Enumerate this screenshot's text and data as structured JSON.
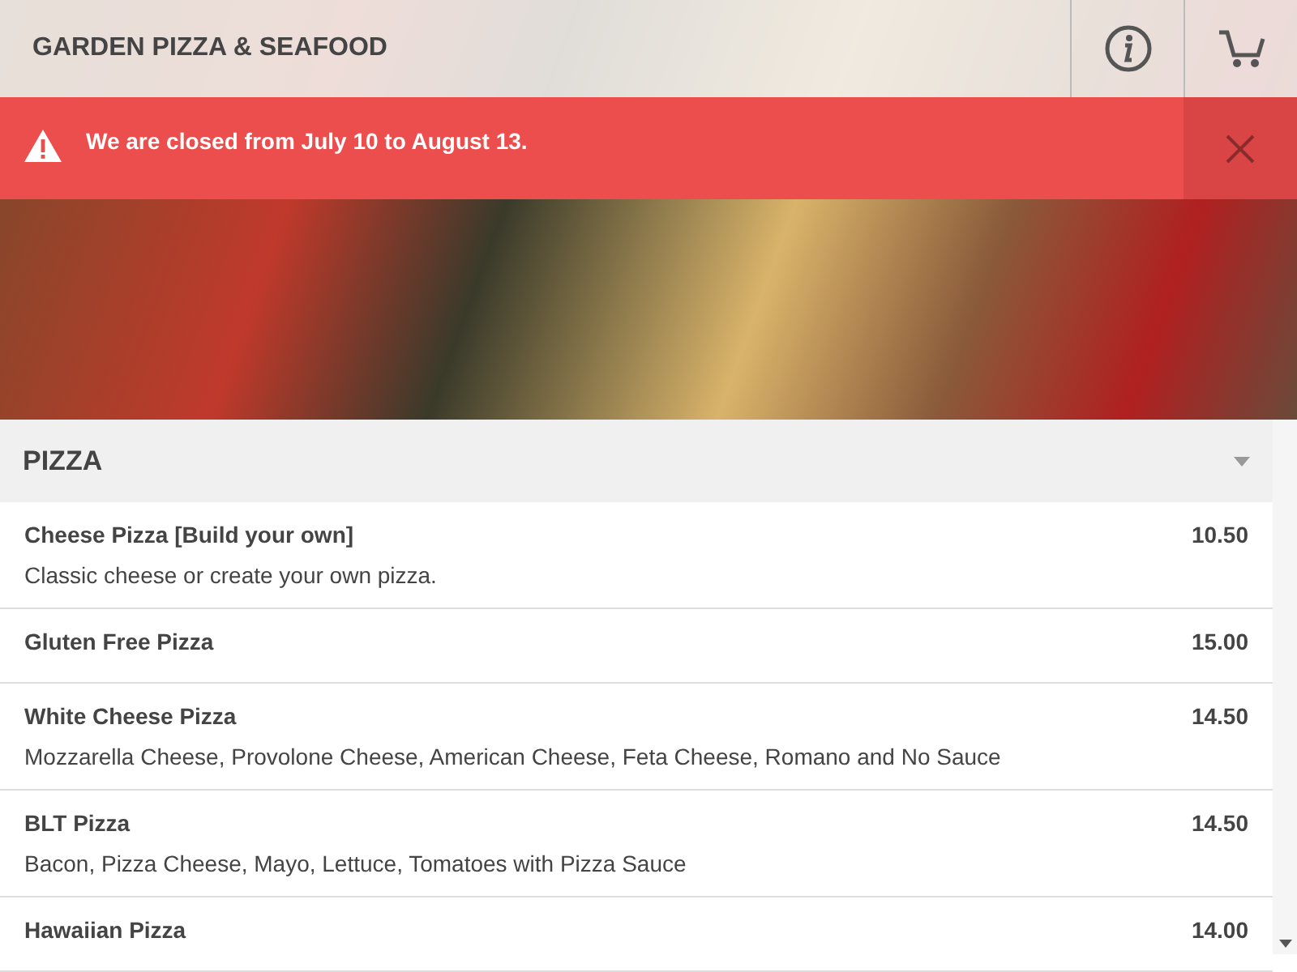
{
  "header": {
    "title": "GARDEN PIZZA & SEAFOOD"
  },
  "alert": {
    "message": "We are closed from July 10 to August 13."
  },
  "category": {
    "title": "PIZZA",
    "expanded": true
  },
  "items": [
    {
      "name": "Cheese Pizza [Build your own]",
      "price": "10.50",
      "description": "Classic cheese or create your own pizza."
    },
    {
      "name": "Gluten Free Pizza",
      "price": "15.00"
    },
    {
      "name": "White Cheese Pizza",
      "price": "14.50",
      "description": "Mozzarella Cheese, Provolone Cheese, American Cheese, Feta Cheese, Romano and No Sauce"
    },
    {
      "name": "BLT Pizza",
      "price": "14.50",
      "description": "Bacon, Pizza Cheese, Mayo, Lettuce, Tomatoes with Pizza Sauce"
    },
    {
      "name": "Hawaiian Pizza",
      "price": "14.00"
    }
  ]
}
